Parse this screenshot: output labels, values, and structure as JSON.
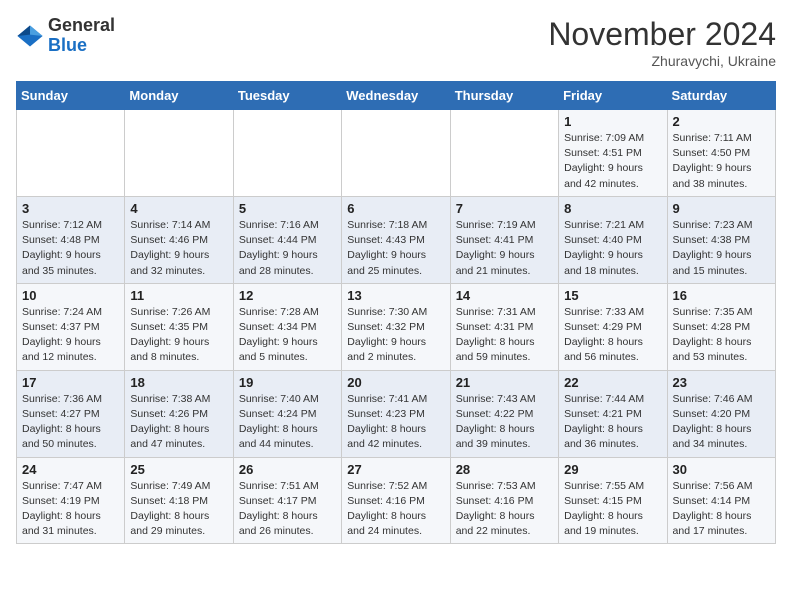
{
  "logo": {
    "general": "General",
    "blue": "Blue"
  },
  "title": "November 2024",
  "location": "Zhuravychi, Ukraine",
  "days_of_week": [
    "Sunday",
    "Monday",
    "Tuesday",
    "Wednesday",
    "Thursday",
    "Friday",
    "Saturday"
  ],
  "weeks": [
    [
      {
        "day": "",
        "info": ""
      },
      {
        "day": "",
        "info": ""
      },
      {
        "day": "",
        "info": ""
      },
      {
        "day": "",
        "info": ""
      },
      {
        "day": "",
        "info": ""
      },
      {
        "day": "1",
        "info": "Sunrise: 7:09 AM\nSunset: 4:51 PM\nDaylight: 9 hours and 42 minutes."
      },
      {
        "day": "2",
        "info": "Sunrise: 7:11 AM\nSunset: 4:50 PM\nDaylight: 9 hours and 38 minutes."
      }
    ],
    [
      {
        "day": "3",
        "info": "Sunrise: 7:12 AM\nSunset: 4:48 PM\nDaylight: 9 hours and 35 minutes."
      },
      {
        "day": "4",
        "info": "Sunrise: 7:14 AM\nSunset: 4:46 PM\nDaylight: 9 hours and 32 minutes."
      },
      {
        "day": "5",
        "info": "Sunrise: 7:16 AM\nSunset: 4:44 PM\nDaylight: 9 hours and 28 minutes."
      },
      {
        "day": "6",
        "info": "Sunrise: 7:18 AM\nSunset: 4:43 PM\nDaylight: 9 hours and 25 minutes."
      },
      {
        "day": "7",
        "info": "Sunrise: 7:19 AM\nSunset: 4:41 PM\nDaylight: 9 hours and 21 minutes."
      },
      {
        "day": "8",
        "info": "Sunrise: 7:21 AM\nSunset: 4:40 PM\nDaylight: 9 hours and 18 minutes."
      },
      {
        "day": "9",
        "info": "Sunrise: 7:23 AM\nSunset: 4:38 PM\nDaylight: 9 hours and 15 minutes."
      }
    ],
    [
      {
        "day": "10",
        "info": "Sunrise: 7:24 AM\nSunset: 4:37 PM\nDaylight: 9 hours and 12 minutes."
      },
      {
        "day": "11",
        "info": "Sunrise: 7:26 AM\nSunset: 4:35 PM\nDaylight: 9 hours and 8 minutes."
      },
      {
        "day": "12",
        "info": "Sunrise: 7:28 AM\nSunset: 4:34 PM\nDaylight: 9 hours and 5 minutes."
      },
      {
        "day": "13",
        "info": "Sunrise: 7:30 AM\nSunset: 4:32 PM\nDaylight: 9 hours and 2 minutes."
      },
      {
        "day": "14",
        "info": "Sunrise: 7:31 AM\nSunset: 4:31 PM\nDaylight: 8 hours and 59 minutes."
      },
      {
        "day": "15",
        "info": "Sunrise: 7:33 AM\nSunset: 4:29 PM\nDaylight: 8 hours and 56 minutes."
      },
      {
        "day": "16",
        "info": "Sunrise: 7:35 AM\nSunset: 4:28 PM\nDaylight: 8 hours and 53 minutes."
      }
    ],
    [
      {
        "day": "17",
        "info": "Sunrise: 7:36 AM\nSunset: 4:27 PM\nDaylight: 8 hours and 50 minutes."
      },
      {
        "day": "18",
        "info": "Sunrise: 7:38 AM\nSunset: 4:26 PM\nDaylight: 8 hours and 47 minutes."
      },
      {
        "day": "19",
        "info": "Sunrise: 7:40 AM\nSunset: 4:24 PM\nDaylight: 8 hours and 44 minutes."
      },
      {
        "day": "20",
        "info": "Sunrise: 7:41 AM\nSunset: 4:23 PM\nDaylight: 8 hours and 42 minutes."
      },
      {
        "day": "21",
        "info": "Sunrise: 7:43 AM\nSunset: 4:22 PM\nDaylight: 8 hours and 39 minutes."
      },
      {
        "day": "22",
        "info": "Sunrise: 7:44 AM\nSunset: 4:21 PM\nDaylight: 8 hours and 36 minutes."
      },
      {
        "day": "23",
        "info": "Sunrise: 7:46 AM\nSunset: 4:20 PM\nDaylight: 8 hours and 34 minutes."
      }
    ],
    [
      {
        "day": "24",
        "info": "Sunrise: 7:47 AM\nSunset: 4:19 PM\nDaylight: 8 hours and 31 minutes."
      },
      {
        "day": "25",
        "info": "Sunrise: 7:49 AM\nSunset: 4:18 PM\nDaylight: 8 hours and 29 minutes."
      },
      {
        "day": "26",
        "info": "Sunrise: 7:51 AM\nSunset: 4:17 PM\nDaylight: 8 hours and 26 minutes."
      },
      {
        "day": "27",
        "info": "Sunrise: 7:52 AM\nSunset: 4:16 PM\nDaylight: 8 hours and 24 minutes."
      },
      {
        "day": "28",
        "info": "Sunrise: 7:53 AM\nSunset: 4:16 PM\nDaylight: 8 hours and 22 minutes."
      },
      {
        "day": "29",
        "info": "Sunrise: 7:55 AM\nSunset: 4:15 PM\nDaylight: 8 hours and 19 minutes."
      },
      {
        "day": "30",
        "info": "Sunrise: 7:56 AM\nSunset: 4:14 PM\nDaylight: 8 hours and 17 minutes."
      }
    ]
  ]
}
